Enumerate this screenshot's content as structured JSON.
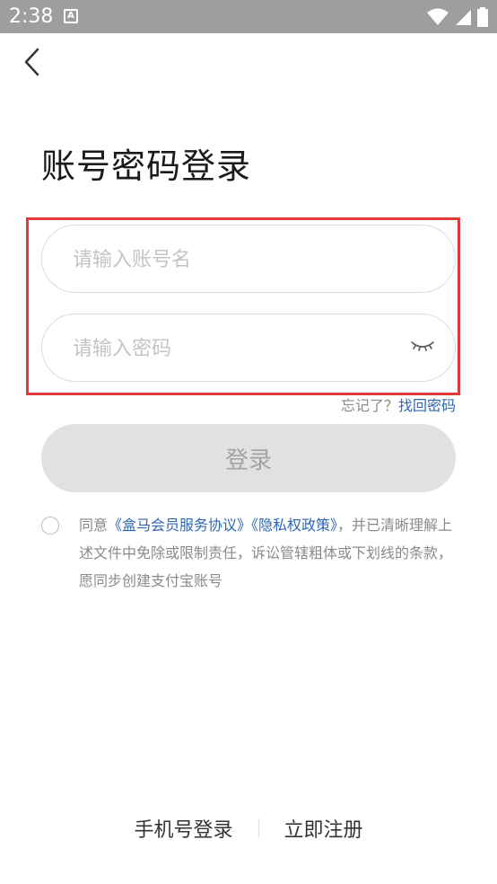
{
  "status_bar": {
    "time": "2:38",
    "notification_icon": "A"
  },
  "page": {
    "title": "账号密码登录"
  },
  "form": {
    "username_placeholder": "请输入账号名",
    "password_placeholder": "请输入密码",
    "forgot_text": "忘记了？",
    "forgot_link": "找回密码",
    "login_label": "登录"
  },
  "agreement": {
    "prefix": "同意",
    "member_link": "《盒马会员服务协议》",
    "privacy_link": "《隐私权政策》",
    "suffix": "，并已清晰理解上述文件中免除或限制责任，诉讼管辖粗体或下划线的条款，愿同步创建支付宝账号"
  },
  "bottom": {
    "phone_login": "手机号登录",
    "register": "立即注册"
  },
  "colors": {
    "link": "#2d67b3",
    "highlight": "#e03a3a",
    "status_bar": "#9e9e9e"
  }
}
